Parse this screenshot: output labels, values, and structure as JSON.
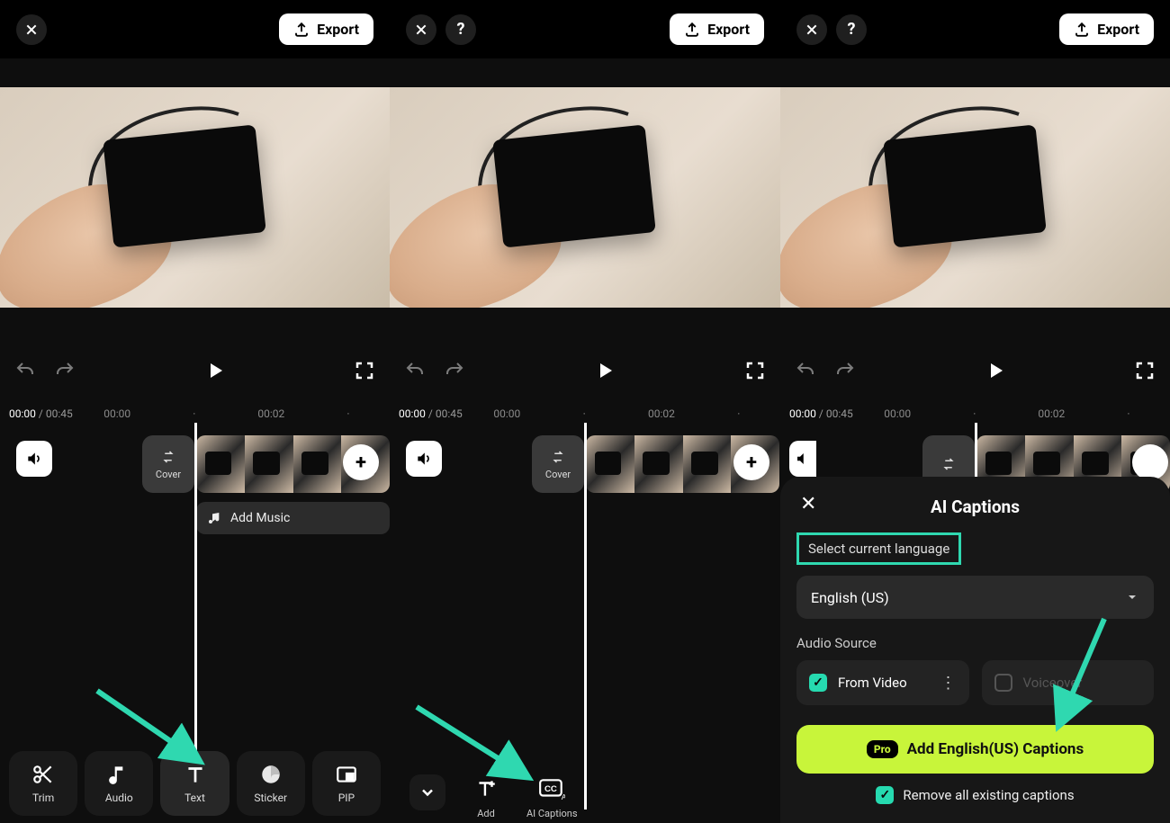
{
  "export_label": "Export",
  "time": {
    "current": "00:00",
    "total": "00:45"
  },
  "ruler": {
    "t1": "00:00",
    "t2": "00:02"
  },
  "cover_label": "Cover",
  "add_music_label": "Add Music",
  "tools": {
    "trim": "Trim",
    "audio": "Audio",
    "text": "Text",
    "sticker": "Sticker",
    "pip": "PIP"
  },
  "tools2": {
    "add": "Add",
    "ai_captions": "AI Captions"
  },
  "sheet": {
    "title": "AI Captions",
    "select_lang_label": "Select current language",
    "language": "English (US)",
    "audio_source_label": "Audio Source",
    "from_video": "From Video",
    "voiceover": "Voiceover",
    "cta_pro": "Pro",
    "cta_label": "Add English(US) Captions",
    "remove_label": "Remove all existing captions"
  },
  "colors": {
    "accent_teal": "#2fd8b0",
    "accent_lime": "#c8f53a"
  }
}
